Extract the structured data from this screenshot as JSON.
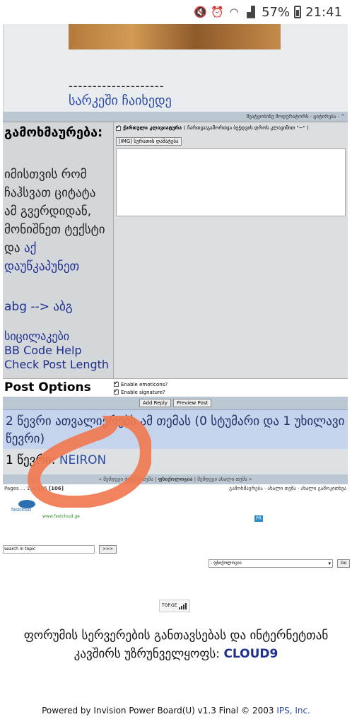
{
  "status": {
    "battery": "57%",
    "time": "21:41"
  },
  "post": {
    "dashes": "--------------------",
    "signature": "სარკეში ჩაიხედე"
  },
  "mod_bar": "შეატყობინე მოდერატორს · ციტირება · ^",
  "reply": {
    "title": "გამოხმაურება:",
    "note": "იმისთვის რომ ჩაჰსვათ ციტატა ამ გვერდიდან, მონიშნეთ ტექსტი და",
    "note_link": "აქ დაუწკაპუნეთ",
    "abg": "abg --> აბგ",
    "links": [
      "სიცილაკები",
      "BB Code Help",
      "Check Post Length"
    ],
    "keyboard_label": "ქართული კლავიატურა",
    "keyboard_hint": "( ჩართვა/გამორთვა ბეჭდვის დროს კლავიშით \"~\" )",
    "img_button": "[IMG] სურათის დამატება"
  },
  "options": {
    "title": "Post Options",
    "emoticons": "Enable emoticons?",
    "signature": "Enable signature?"
  },
  "buttons": {
    "add": "Add Reply",
    "preview": "Preview Post"
  },
  "readers": {
    "line": "2 წევრი ათვალიერებს ამ თემას (0 სტუმარი და 1 უხილავი წევრი)",
    "members_label": "1 წევრი:",
    "member": "NEIRON"
  },
  "nav": {
    "prev": "« შემდეგი ძველი თემა",
    "forum": "ფსიქოლოგია",
    "next": "შემდეგი ახალი თემა »"
  },
  "pages": {
    "label": "Pages ... 104 105",
    "current": "[106]",
    "actions": "გამოხმაურება · ახალი თემა · ახალი გამოკითხვა"
  },
  "footer": {
    "fastcloud_url": "www.fastcloud.ge",
    "pr": "PR",
    "search_placeholder": "search in topic",
    "search_go": ">>>",
    "jump_value": "- ფსიქოლოგია",
    "jump_go": "Go",
    "topge": "TOP.GE",
    "host_line": "ფორუმის სერვერების განთავსებას და ინტერნეტთან კავშირს უზრუნველყოფს:",
    "host_name": "CLOUD9",
    "powered": "Powered by Invision Power Board(U) v1.3 Final © 2003",
    "ips": "IPS, Inc."
  },
  "colors": {
    "link": "#1f2f8f",
    "annotation": "#f07a50"
  }
}
